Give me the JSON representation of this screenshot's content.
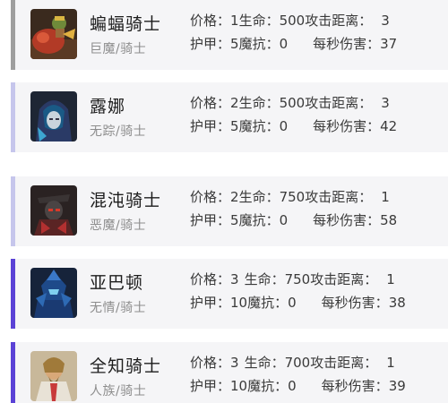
{
  "colors": {
    "card_bg": "#f5f5f7",
    "bar_gray": "#9e9e9e",
    "bar_lavender": "#c6c6ec",
    "bar_purple": "#5b43d6"
  },
  "heroes": [
    {
      "name": "蝙蝠骑士",
      "faction": "巨魔/骑士",
      "accent": "gray",
      "portrait_icon": "batrider-portrait-icon",
      "line1": {
        "cost_label": "价格：",
        "cost": "1",
        "hp_label": "生命：",
        "hp": "500",
        "range_label": "攻击距离：",
        "range": "3"
      },
      "line2": {
        "armor_label": "护甲：",
        "armor": "5",
        "mr_label": "魔抗：",
        "mr": "0",
        "dps_label": "每秒伤害：",
        "dps": "37"
      }
    },
    {
      "name": "露娜",
      "faction": "无踪/骑士",
      "accent": "lavender",
      "portrait_icon": "luna-portrait-icon",
      "line1": {
        "cost_label": "价格：",
        "cost": "2",
        "hp_label": "生命：",
        "hp": "500",
        "range_label": "攻击距离：",
        "range": "3"
      },
      "line2": {
        "armor_label": "护甲：",
        "armor": "5",
        "mr_label": "魔抗：",
        "mr": "0",
        "dps_label": "每秒伤害：",
        "dps": "42"
      }
    },
    {
      "name": "混沌骑士",
      "faction": "恶魔/骑士",
      "accent": "lavender",
      "portrait_icon": "chaos-knight-portrait-icon",
      "line1": {
        "cost_label": "价格：",
        "cost": "2",
        "hp_label": "生命：",
        "hp": "750",
        "range_label": "攻击距离：",
        "range": "1"
      },
      "line2": {
        "armor_label": "护甲：",
        "armor": "5",
        "mr_label": "魔抗：",
        "mr": "0",
        "dps_label": "每秒伤害：",
        "dps": "58"
      }
    },
    {
      "name": "亚巴顿",
      "faction": "无情/骑士",
      "accent": "purple",
      "portrait_icon": "abaddon-portrait-icon",
      "line1": {
        "cost_label": "价格：",
        "cost": "3",
        "hp_label": "生命：",
        "hp": "750",
        "range_label": "攻击距离：",
        "range": "1"
      },
      "line2": {
        "armor_label": "护甲：",
        "armor": "10",
        "mr_label": "魔抗：",
        "mr": "0",
        "dps_label": "每秒伤害：",
        "dps": "38"
      }
    },
    {
      "name": "全知骑士",
      "faction": "人族/骑士",
      "accent": "purple",
      "portrait_icon": "omniknight-portrait-icon",
      "line1": {
        "cost_label": "价格：",
        "cost": "3",
        "hp_label": "生命：",
        "hp": "700",
        "range_label": "攻击距离：",
        "range": "1"
      },
      "line2": {
        "armor_label": "护甲：",
        "armor": "10",
        "mr_label": "魔抗：",
        "mr": "0",
        "dps_label": "每秒伤害：",
        "dps": "39"
      }
    }
  ]
}
